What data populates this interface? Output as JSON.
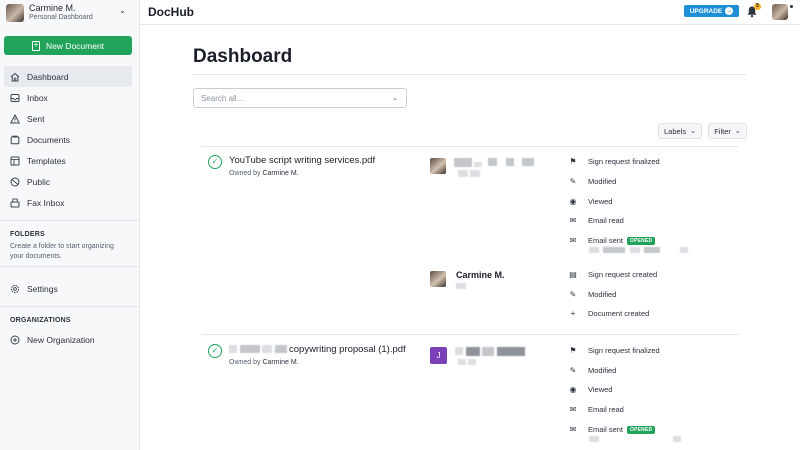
{
  "account": {
    "name": "Carmine M.",
    "subtitle": "Personal Dashboard"
  },
  "app": {
    "brand": "DocHub",
    "upgrade_label": "UPGRADE",
    "notif_count": "5"
  },
  "sidebar": {
    "new_document": "New Document",
    "items": [
      {
        "label": "Dashboard",
        "icon": "home-icon"
      },
      {
        "label": "Inbox",
        "icon": "inbox-icon"
      },
      {
        "label": "Sent",
        "icon": "sent-icon"
      },
      {
        "label": "Documents",
        "icon": "documents-icon"
      },
      {
        "label": "Templates",
        "icon": "templates-icon"
      },
      {
        "label": "Public",
        "icon": "globe-icon"
      },
      {
        "label": "Fax Inbox",
        "icon": "fax-icon"
      }
    ],
    "folders_heading": "FOLDERS",
    "folders_hint": "Create a folder to start organizing your documents.",
    "settings": "Settings",
    "organizations_heading": "ORGANIZATIONS",
    "new_organization": "New Organization"
  },
  "main": {
    "title": "Dashboard",
    "search_placeholder": "Search all...",
    "labels_button": "Labels",
    "filter_button": "Filter",
    "documents": [
      {
        "name": "YouTube script writing services.pdf",
        "owner_prefix": "Owned by",
        "owner": "Carmine M.",
        "groups": [
          {
            "person": "",
            "activities": [
              "Sign request finalized",
              "Modified",
              "Viewed",
              "Email read",
              "Email sent"
            ]
          },
          {
            "person": "Carmine M.",
            "activities": [
              "Sign request created",
              "Modified",
              "Document created"
            ]
          }
        ]
      },
      {
        "name": "copywriting proposal (1).pdf",
        "owner_prefix": "Owned by",
        "owner": "Carmine M.",
        "groups": [
          {
            "person": "",
            "avatar_letter": "J",
            "activities": [
              "Sign request finalized",
              "Modified",
              "Viewed",
              "Email read",
              "Email sent"
            ]
          }
        ]
      }
    ],
    "opened_badge": "OPENED"
  },
  "colors": {
    "accent_green": "#22a35a",
    "upgrade_blue": "#1e8fd6",
    "avatar_purple": "#7b3fb8"
  }
}
